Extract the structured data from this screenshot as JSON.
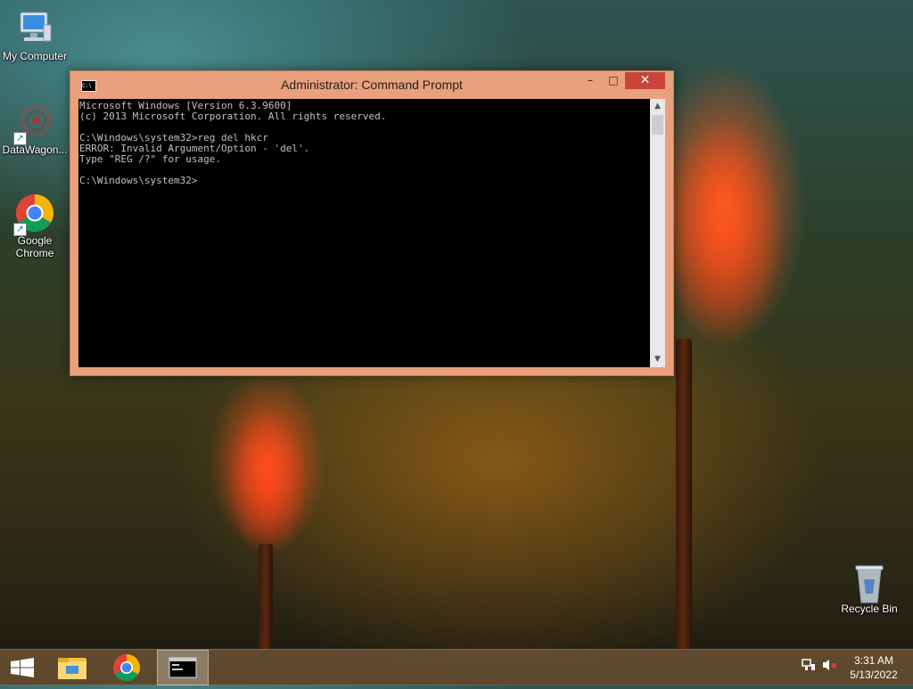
{
  "desktop": {
    "icons": [
      {
        "label": "My Computer",
        "icon": "computer-icon"
      },
      {
        "label": "DataWagon...",
        "icon": "datawagon-icon"
      },
      {
        "label": "Google Chrome",
        "icon": "chrome-icon"
      },
      {
        "label": "Recycle Bin",
        "icon": "recycle-bin-icon"
      }
    ]
  },
  "window": {
    "title": "Administrator: Command Prompt",
    "console_text": "Microsoft Windows [Version 6.3.9600]\n(c) 2013 Microsoft Corporation. All rights reserved.\n\nC:\\Windows\\system32>reg del hkcr\nERROR: Invalid Argument/Option - 'del'.\nType \"REG /?\" for usage.\n\nC:\\Windows\\system32>",
    "controls": {
      "minimize": "–",
      "maximize": "□",
      "close": "✕"
    }
  },
  "taskbar": {
    "items": [
      "windows-start-icon",
      "file-explorer-icon",
      "chrome-icon",
      "command-prompt-icon"
    ],
    "active_item": "command-prompt-icon",
    "clock_time": "3:31 AM",
    "clock_date": "5/13/2022"
  },
  "colors": {
    "title_bar": "#e9a07c",
    "close_button": "#c7453a",
    "console_bg": "#000000",
    "console_text": "#c0c0c0"
  }
}
